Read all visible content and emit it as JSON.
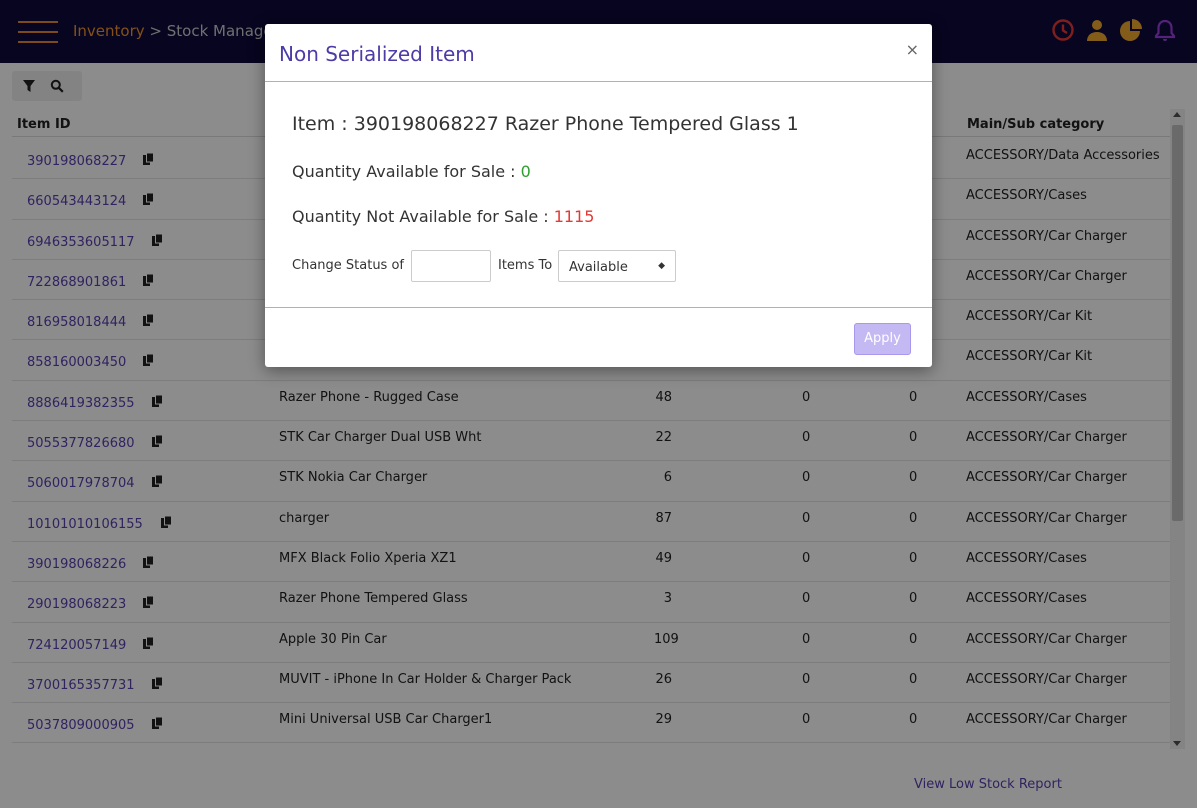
{
  "header": {
    "crumb_root": "Inventory",
    "crumb_sep": " > ",
    "crumb_page": "Stock Management"
  },
  "table": {
    "columns": [
      "Item ID",
      "Main/Sub category"
    ],
    "rows": [
      {
        "id": "390198068227",
        "name": "",
        "q1": "",
        "q2": "",
        "q3": "",
        "cat": "ACCESSORY/Data Accessories"
      },
      {
        "id": "660543443124",
        "name": "",
        "q1": "",
        "q2": "",
        "q3": "",
        "cat": "ACCESSORY/Cases"
      },
      {
        "id": "6946353605117",
        "name": "",
        "q1": "",
        "q2": "",
        "q3": "",
        "cat": "ACCESSORY/Car Charger"
      },
      {
        "id": "722868901861",
        "name": "",
        "q1": "",
        "q2": "",
        "q3": "",
        "cat": "ACCESSORY/Car Charger"
      },
      {
        "id": "816958018444",
        "name": "",
        "q1": "",
        "q2": "",
        "q3": "",
        "cat": "ACCESSORY/Car Kit"
      },
      {
        "id": "858160003450",
        "name": "",
        "q1": "",
        "q2": "",
        "q3": "",
        "cat": "ACCESSORY/Car Kit"
      },
      {
        "id": "8886419382355",
        "name": "Razer Phone - Rugged Case",
        "q1": "48",
        "q2": "0",
        "q3": "0",
        "cat": "ACCESSORY/Cases"
      },
      {
        "id": "5055377826680",
        "name": "STK Car Charger Dual USB Wht",
        "q1": "22",
        "q2": "0",
        "q3": "0",
        "cat": "ACCESSORY/Car Charger"
      },
      {
        "id": "5060017978704",
        "name": "STK Nokia Car Charger",
        "q1": "6",
        "q2": "0",
        "q3": "0",
        "cat": "ACCESSORY/Car Charger"
      },
      {
        "id": "10101010106155",
        "name": "charger",
        "q1": "87",
        "q2": "0",
        "q3": "0",
        "cat": "ACCESSORY/Car Charger"
      },
      {
        "id": "390198068226",
        "name": "MFX Black Folio Xperia XZ1",
        "q1": "49",
        "q2": "0",
        "q3": "0",
        "cat": "ACCESSORY/Cases"
      },
      {
        "id": "290198068223",
        "name": "Razer Phone Tempered Glass",
        "q1": "3",
        "q2": "0",
        "q3": "0",
        "cat": "ACCESSORY/Cases"
      },
      {
        "id": "724120057149",
        "name": "Apple 30 Pin Car",
        "q1": "109",
        "q2": "0",
        "q3": "0",
        "cat": "ACCESSORY/Car Charger"
      },
      {
        "id": "3700165357731",
        "name": "MUVIT - iPhone In Car Holder & Charger Pack",
        "q1": "26",
        "q2": "0",
        "q3": "0",
        "cat": "ACCESSORY/Car Charger"
      },
      {
        "id": "5037809000905",
        "name": "Mini Universal USB Car Charger1",
        "q1": "29",
        "q2": "0",
        "q3": "0",
        "cat": "ACCESSORY/Car Charger"
      }
    ]
  },
  "footer": {
    "low_stock_link": "View Low Stock Report"
  },
  "modal": {
    "title": "Non Serialized Item",
    "close": "×",
    "item_label": "Item : ",
    "item_value": "390198068227 Razer Phone Tempered Glass 1",
    "qa_label": "Quantity Available for Sale : ",
    "qa_value": "0",
    "qna_label": "Quantity Not Available for Sale : ",
    "qna_value": "1115",
    "change_status_label": "Change Status of",
    "items_to_label": "Items To",
    "quantity_value": "",
    "status_selected": "Available",
    "apply_label": "Apply"
  },
  "colors": {
    "topbar": "#0d0a3a",
    "accent_orange": "#f0932b",
    "link_purple": "#5a3fb0",
    "available_green": "#2e9e2e",
    "unavailable_red": "#e53935",
    "apply_disabled": "#c4b9f2"
  },
  "icons": {
    "menu": "hamburger-icon",
    "history": "clock-icon",
    "user": "user-icon",
    "chart": "pie-chart-icon",
    "notifications": "bell-icon",
    "filter": "filter-icon",
    "search": "search-icon",
    "copy": "copy-icon",
    "select_caret": "sort-caret-icon"
  }
}
